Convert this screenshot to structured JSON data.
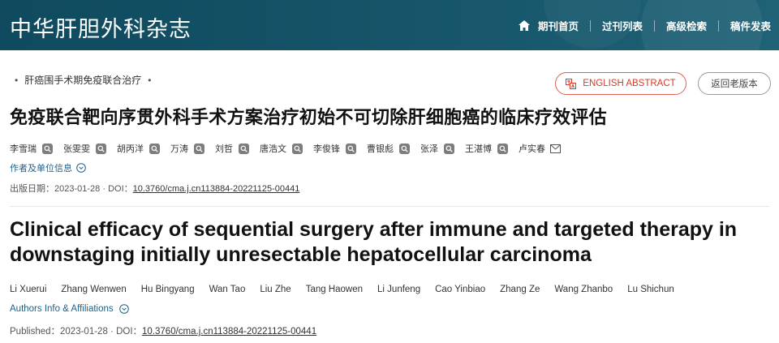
{
  "header": {
    "logo": "中华肝胆外科杂志",
    "nav": [
      {
        "label": "期刊首页",
        "icon": "home-icon"
      },
      {
        "label": "过刊列表"
      },
      {
        "label": "高级检索"
      },
      {
        "label": "稿件发表"
      }
    ],
    "bg_color": "#17566b"
  },
  "article": {
    "section": "肝癌围手术期免疫联合治疗",
    "english_abstract_button": "ENGLISH ABSTRACT",
    "old_version_button": "返回老版本",
    "title_cn": "免疫联合靶向序贯外科手术方案治疗初始不可切除肝细胞癌的临床疗效评估",
    "authors_cn": [
      "李雪瑞",
      "张雯雯",
      "胡丙洋",
      "万涛",
      "刘哲",
      "唐浩文",
      "李俊锋",
      "曹银彪",
      "张泽",
      "王湛博",
      "卢实春"
    ],
    "affiliation_link_cn": "作者及单位信息",
    "pub_label_cn": "出版日期：",
    "pub_date": "2023-01-28",
    "doi_label": "DOI：",
    "doi": "10.3760/cma.j.cn113884-20221125-00441",
    "title_en": "Clinical efficacy of sequential surgery after immune and targeted therapy in downstaging initially unresectable hepatocellular carcinoma",
    "authors_en": [
      "Li Xuerui",
      "Zhang Wenwen",
      "Hu Bingyang",
      "Wan Tao",
      "Liu Zhe",
      "Tang Haowen",
      "Li Junfeng",
      "Cao Yinbiao",
      "Zhang Ze",
      "Wang Zhanbo",
      "Lu Shichun"
    ],
    "affiliation_link_en": "Authors Info & Affiliations",
    "pub_label_en": "Published：",
    "doi_label_en": "DOI："
  },
  "colors": {
    "accent_red": "#d33a2a",
    "link_blue": "#1f5f86"
  }
}
